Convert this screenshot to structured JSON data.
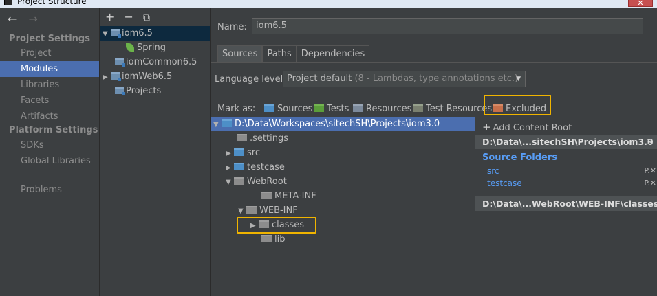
{
  "window": {
    "title": "Project Structure",
    "close": "✕"
  },
  "nav": {
    "back": "←",
    "forward": "→",
    "project_settings": "Project Settings",
    "project_items": [
      "Project",
      "Modules",
      "Libraries",
      "Facets",
      "Artifacts"
    ],
    "platform_settings": "Platform Settings",
    "platform_items": [
      "SDKs",
      "Global Libraries"
    ],
    "problems": "Problems",
    "active": "Modules"
  },
  "modules_panel": {
    "toolbar": {
      "add": "+",
      "remove": "−",
      "copy": "⧉"
    },
    "tree": [
      {
        "label": "iom6.5",
        "expanded": true,
        "selected": true
      },
      {
        "label": "Spring",
        "child": true
      },
      {
        "label": "iomCommon6.5"
      },
      {
        "label": "iomWeb6.5",
        "collapsed": true
      },
      {
        "label": "Projects"
      }
    ]
  },
  "detail": {
    "name_label": "Name:",
    "name_value": "iom6.5",
    "tabs": [
      "Sources",
      "Paths",
      "Dependencies"
    ],
    "active_tab": "Sources",
    "language_label": "Language level:",
    "language_value": "Project default",
    "language_hint": "(8 - Lambdas, type annotations etc.)",
    "mark_as": "Mark as:",
    "mark_options": [
      "Sources",
      "Tests",
      "Resources",
      "Test Resources",
      "Excluded"
    ]
  },
  "content_tree": [
    {
      "label": "D:\\Data\\Workspaces\\sitechSH\\Projects\\iom3.0",
      "toggle": "▼",
      "selected": true
    },
    {
      "label": ".settings",
      "toggle": ""
    },
    {
      "label": "src",
      "toggle": "▶"
    },
    {
      "label": "testcase",
      "toggle": "▶"
    },
    {
      "label": "WebRoot",
      "toggle": "▼"
    },
    {
      "label": "META-INF",
      "toggle": ""
    },
    {
      "label": "WEB-INF",
      "toggle": "▼"
    },
    {
      "label": "classes",
      "toggle": "▶"
    },
    {
      "label": "lib",
      "toggle": ""
    }
  ],
  "roots_panel": {
    "add_content_root": "Add Content Root",
    "root1": "D:\\Data\\...sitechSH\\Projects\\iom3.0",
    "source_folders_title": "Source Folders",
    "source_folders": [
      "src",
      "testcase"
    ],
    "row_actions": "P.✕",
    "root2": "D:\\Data\\...WebRoot\\WEB-INF\\classes",
    "close": "✕"
  },
  "colors": {
    "highlight_box": "#f0b400",
    "selection": "#4b6eaf",
    "source_blue": "#589df6"
  }
}
